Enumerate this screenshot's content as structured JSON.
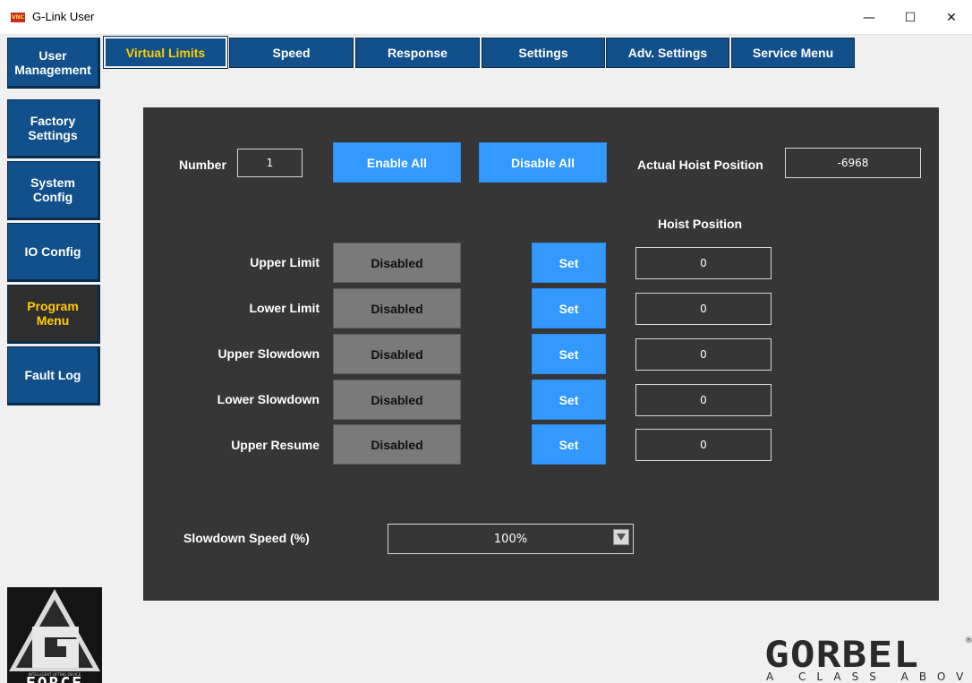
{
  "window": {
    "icon_text": "VNC",
    "title": "G-Link User",
    "minimize": "—",
    "maximize": "☐",
    "close": "✕"
  },
  "sidebar": {
    "items": [
      {
        "label": "User\nManagement"
      },
      {
        "label": "Factory\nSettings"
      },
      {
        "label": "System\nConfig"
      },
      {
        "label": "IO Config"
      },
      {
        "label": "Program\nMenu",
        "active": true
      },
      {
        "label": "Fault Log"
      }
    ]
  },
  "tabs": [
    {
      "label": "Virtual Limits",
      "active": true
    },
    {
      "label": "Speed"
    },
    {
      "label": "Response"
    },
    {
      "label": "Settings"
    },
    {
      "label": "Adv. Settings"
    },
    {
      "label": "Service Menu"
    }
  ],
  "virtual_limits": {
    "number_label": "Number",
    "number_value": "1",
    "enable_all": "Enable All",
    "disable_all": "Disable All",
    "actual_hoist_position_label": "Actual Hoist Position",
    "actual_hoist_position_value": "-6968",
    "hoist_position_header": "Hoist Position",
    "rows": [
      {
        "label": "Upper Limit",
        "state": "Disabled",
        "set": "Set",
        "position": "0"
      },
      {
        "label": "Lower Limit",
        "state": "Disabled",
        "set": "Set",
        "position": "0"
      },
      {
        "label": "Upper Slowdown",
        "state": "Disabled",
        "set": "Set",
        "position": "0"
      },
      {
        "label": "Lower Slowdown",
        "state": "Disabled",
        "set": "Set",
        "position": "0"
      },
      {
        "label": "Upper Resume",
        "state": "Disabled",
        "set": "Set",
        "position": "0"
      }
    ],
    "slowdown_speed_label": "Slowdown Speed (%)",
    "slowdown_speed_value": "100%"
  },
  "logos": {
    "gforce_tagline": "INTELLIGENT LIFTING DEVICE",
    "gforce_word": "FORCE",
    "gorbel_word": "GORBEL",
    "gorbel_registered": "®",
    "gorbel_tagline": "A CLASS ABOVE"
  },
  "colors": {
    "sidebar_blue": "#11508b",
    "active_yellow": "#ffcc00",
    "panel_dark": "#363636",
    "accent_blue": "#3399ff",
    "disabled_gray": "#7a7a7a"
  }
}
